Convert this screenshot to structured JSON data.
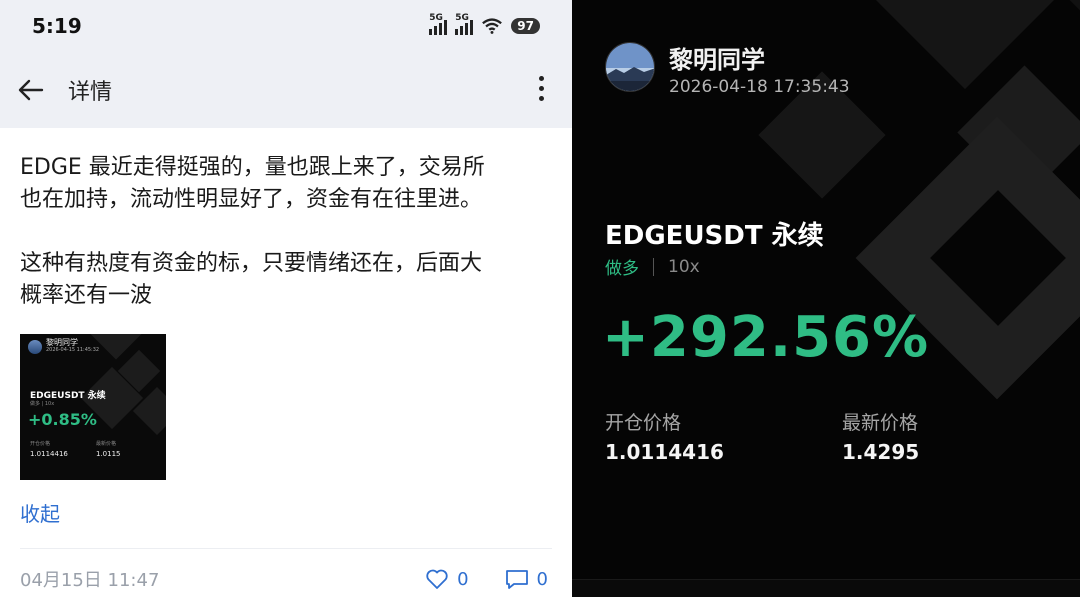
{
  "status_bar": {
    "time": "5:19",
    "signal1": "5G",
    "signal2": "5G",
    "battery": "97"
  },
  "header": {
    "title": "详情"
  },
  "post": {
    "paragraph1_line1": "EDGE 最近走得挺强的，量也跟上来了，交易所",
    "paragraph1_line2": "也在加持，流动性明显好了，资金有在往里进。",
    "paragraph2_line1": "这种有热度有资金的标，只要情绪还在，后面大",
    "paragraph2_line2": "概率还有一波",
    "collapse_label": "收起",
    "date": "04月15日 11:47",
    "likes": "0",
    "comments": "0"
  },
  "thumbnail": {
    "name": "黎明同学",
    "date": "2026-04-15 11:45:32",
    "symbol": "EDGEUSDT 永续",
    "side": "做多 | 10x",
    "pnl": "+0.85%",
    "entry_label": "开仓价格",
    "latest_label": "最新价格",
    "entry_value": "1.0114416",
    "latest_value": "1.0115"
  },
  "card": {
    "username": "黎明同学",
    "datetime": "2026-04-18 17:35:43",
    "symbol": "EDGEUSDT 永续",
    "side": "做多",
    "leverage": "10x",
    "pnl": "+292.56%",
    "entry_label": "开仓价格",
    "entry_value": "1.0114416",
    "latest_label": "最新价格",
    "latest_value": "1.4295"
  },
  "colors": {
    "profit_green": "#2fbd85",
    "link_blue": "#2f6fd0",
    "card_bg": "#050505",
    "header_bg": "#eef0f5"
  },
  "icons": [
    "back-arrow-icon",
    "more-vertical-icon",
    "signal-icon",
    "wifi-icon",
    "battery-icon",
    "heart-icon",
    "comment-icon"
  ]
}
